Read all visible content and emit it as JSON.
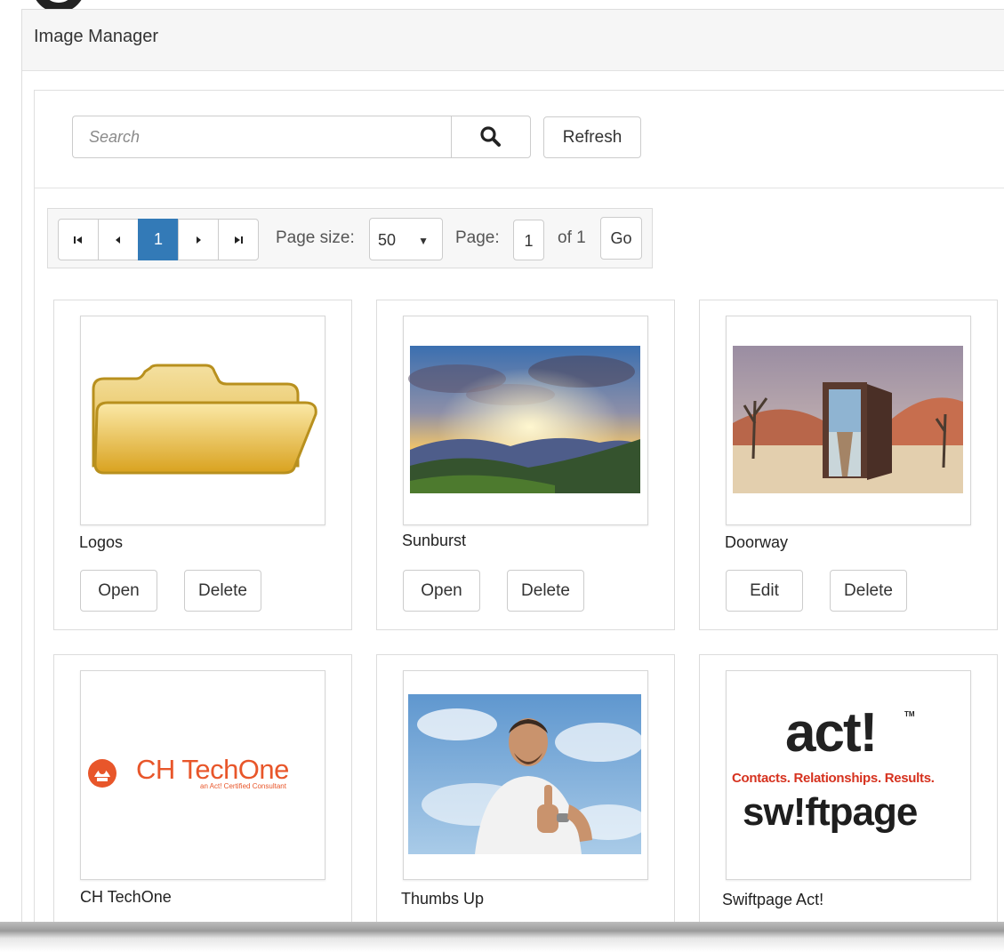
{
  "window": {
    "title": "Image Manager"
  },
  "search": {
    "placeholder": "Search",
    "icon": "search-icon"
  },
  "toolbar": {
    "refresh_label": "Refresh"
  },
  "pager": {
    "first_icon": "first-page-icon",
    "prev_icon": "prev-page-icon",
    "current_page": "1",
    "next_icon": "next-page-icon",
    "last_icon": "last-page-icon",
    "page_size_label": "Page size:",
    "page_size_value": "50",
    "page_label": "Page:",
    "page_input_value": "1",
    "of_label": "of 1",
    "go_label": "Go"
  },
  "cards": [
    {
      "title": "Logos",
      "primary": "Open",
      "secondary": "Delete",
      "thumb": "folder-icon"
    },
    {
      "title": "Sunburst",
      "primary": "Open",
      "secondary": "Delete",
      "thumb": "sunburst-landscape-image"
    },
    {
      "title": "Doorway",
      "primary": "Edit",
      "secondary": "Delete",
      "thumb": "desert-doorway-image"
    },
    {
      "title": "CH TechOne",
      "thumb": "ch-techone-logo",
      "logo_text": "CH TechOne",
      "logo_sub": "an Act! Certified Consultant"
    },
    {
      "title": "Thumbs Up",
      "thumb": "thumbs-up-photo"
    },
    {
      "title": "Swiftpage Act!",
      "thumb": "swiftpage-act-logo",
      "logo_text": "act!",
      "logo_tm": "TM",
      "logo_tagline": "Contacts. Relationships. Results.",
      "logo_brand": "sw!ftpage"
    }
  ],
  "colors": {
    "accent": "#337ab7",
    "folder": "#e3b53a",
    "techone_orange": "#e8562a",
    "act_red": "#d6321f"
  }
}
